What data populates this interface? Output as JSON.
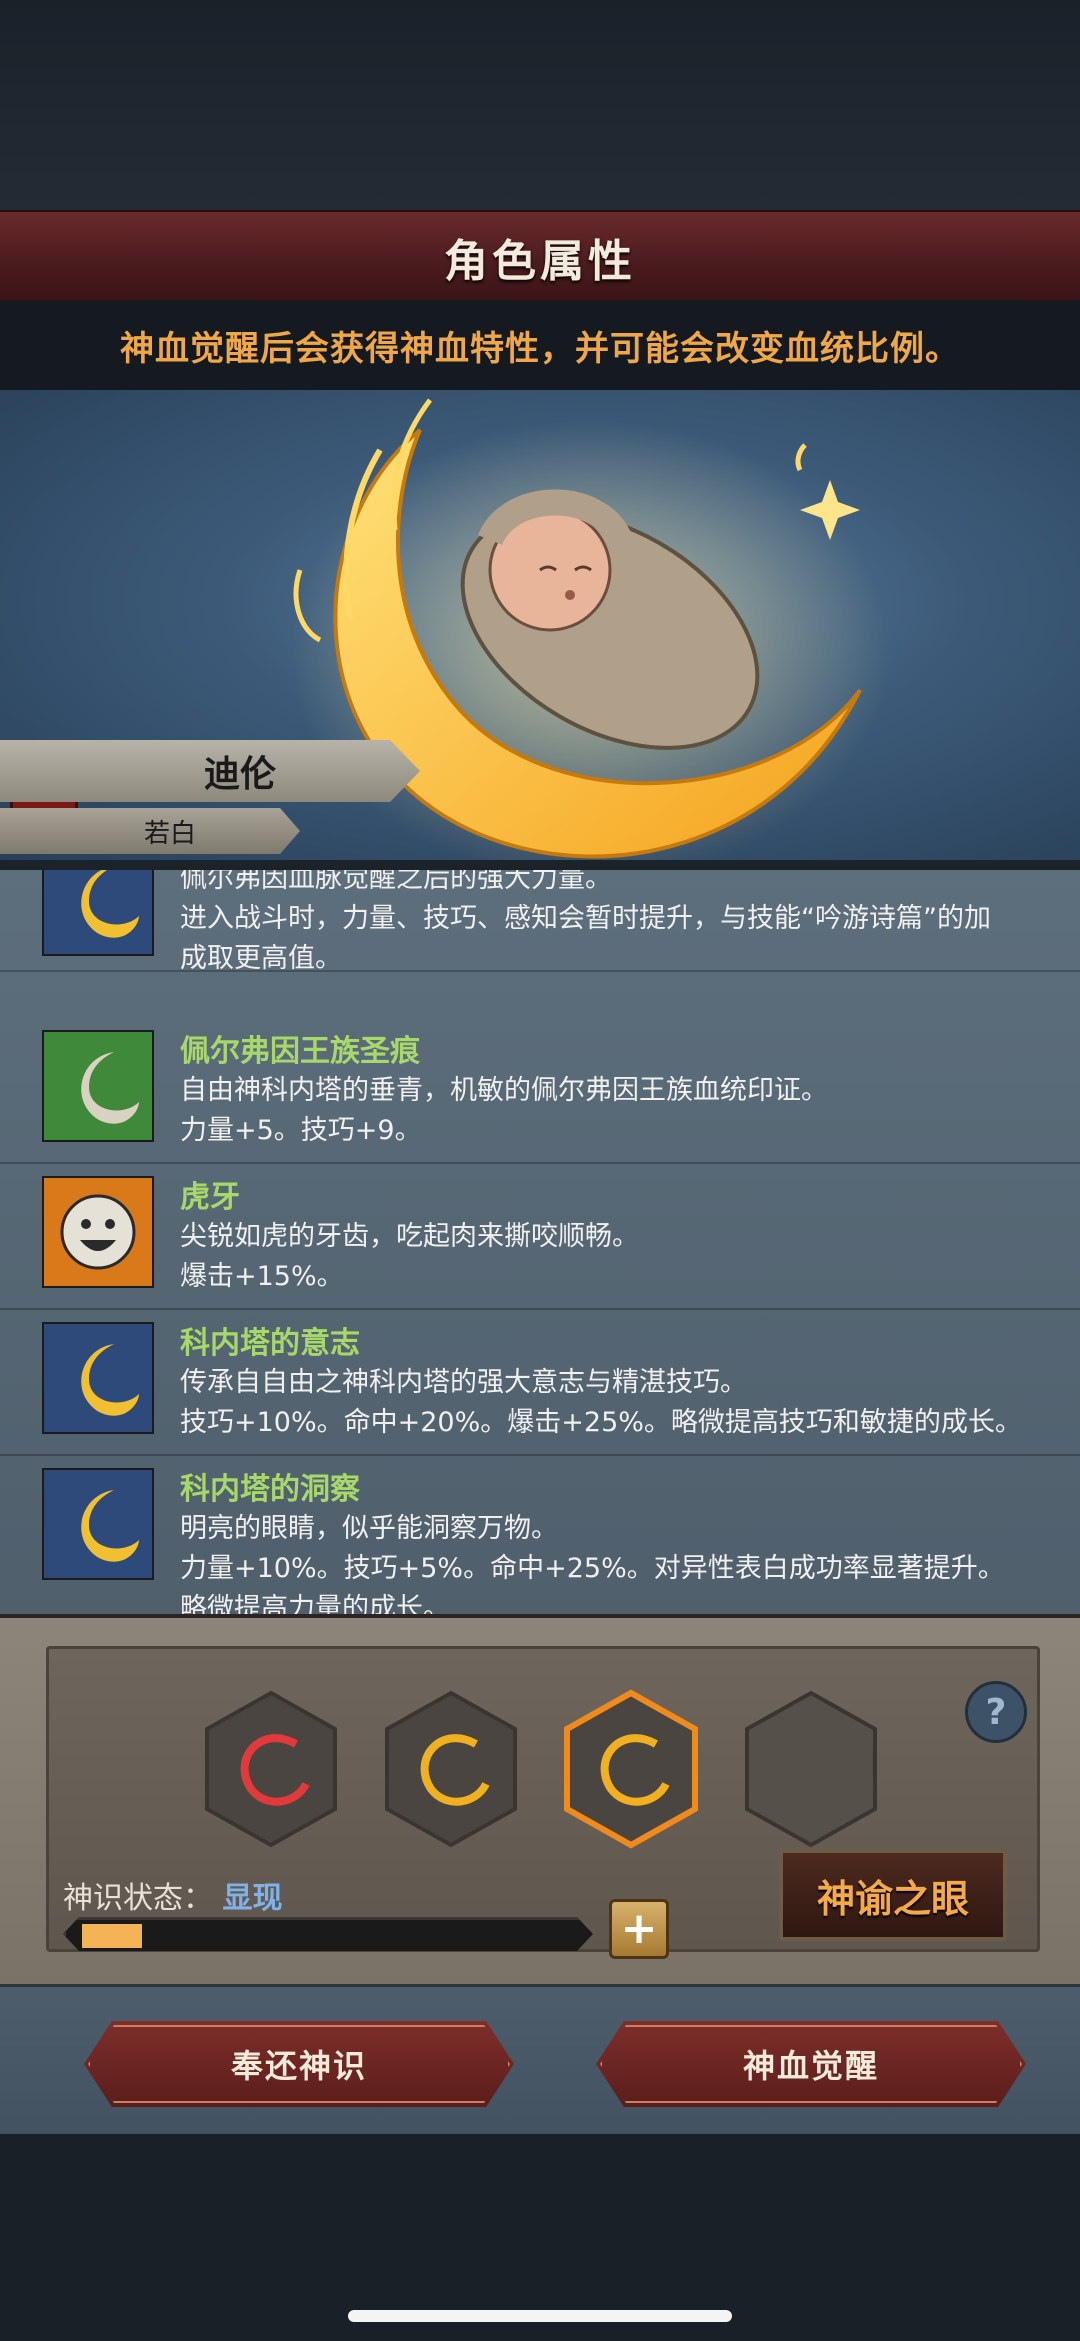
{
  "header": {
    "title": "角色属性",
    "hint": "神血觉醒后会获得神血特性，并可能会改变血统比例。"
  },
  "character": {
    "name": "迪伦",
    "subtitle": "若白"
  },
  "traits": [
    {
      "name": "",
      "icon": "moon-icon",
      "lines": [
        "佩尔弗因血脉觉醒之后的强大力量。",
        "进入战斗时，力量、技巧、感知会暂时提升，与技能“吟游诗篇”的加",
        "成取更高值。"
      ]
    },
    {
      "name": "佩尔弗因王族圣痕",
      "icon": "white-moon-icon",
      "lines": [
        "自由神科内塔的垂青，机敏的佩尔弗因王族血统印证。",
        "力量+5。技巧+9。"
      ]
    },
    {
      "name": "虎牙",
      "icon": "smiley-icon",
      "lines": [
        "尖锐如虎的牙齿，吃起肉来撕咬顺畅。",
        "爆击+15%。"
      ]
    },
    {
      "name": "科内塔的意志",
      "icon": "moon-icon",
      "lines": [
        "传承自自由之神科内塔的强大意志与精湛技巧。",
        "技巧+10%。命中+20%。爆击+25%。略微提高技巧和敏捷的成长。"
      ]
    },
    {
      "name": "科内塔的洞察",
      "icon": "moon-icon",
      "lines": [
        "明亮的眼睛，似乎能洞察万物。",
        "力量+10%。技巧+5%。命中+25%。对异性表白成功率显著提升。",
        "略微提高力量的成长。"
      ]
    }
  ],
  "divine_panel": {
    "status_label": "神识状态：",
    "status_value": "显现",
    "progress": 0.12,
    "plus_label": "+",
    "help_label": "?",
    "oracle_button": "神谕之眼",
    "slots": [
      "red",
      "gold",
      "gold-active",
      "empty"
    ]
  },
  "actions": {
    "return_button": "奉还神识",
    "awaken_button": "神血觉醒"
  },
  "colors": {
    "accent": "#f0a748",
    "trait_name": "#a9d86a",
    "status_value": "#7fb2ea"
  }
}
